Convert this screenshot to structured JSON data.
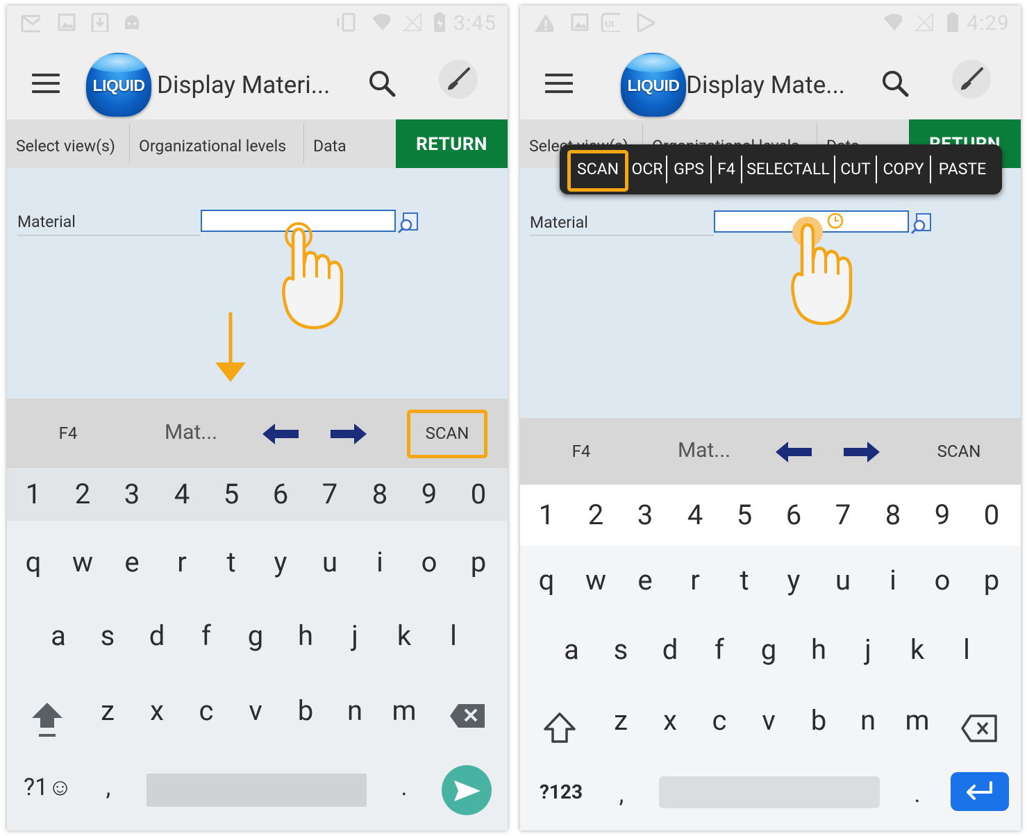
{
  "left": {
    "status": {
      "icons": [
        "gmail-icon",
        "image-icon",
        "download-icon",
        "android-icon",
        "vibrate-icon",
        "wifi-icon",
        "no-signal-icon",
        "battery-charging-icon"
      ],
      "time": "3:45"
    },
    "app_bar": {
      "logo_text": "LIQUID",
      "title": "Display Materi..."
    },
    "tabs": [
      "Select view(s)",
      "Organizational levels",
      "Data"
    ],
    "return_label": "RETURN",
    "form": {
      "material_label": "Material",
      "material_value": ""
    },
    "toolbar": {
      "f4": "F4",
      "field": "Mat...",
      "scan": "SCAN"
    },
    "keyboard": {
      "numbers": [
        "1",
        "2",
        "3",
        "4",
        "5",
        "6",
        "7",
        "8",
        "9",
        "0"
      ],
      "row1": [
        "q",
        "w",
        "e",
        "r",
        "t",
        "y",
        "u",
        "i",
        "o",
        "p"
      ],
      "row2": [
        "a",
        "s",
        "d",
        "f",
        "g",
        "h",
        "j",
        "k",
        "l"
      ],
      "row3": [
        "z",
        "x",
        "c",
        "v",
        "b",
        "n",
        "m"
      ],
      "symbols": "?1☺",
      "comma": ",",
      "period": "."
    }
  },
  "right": {
    "status": {
      "icons": [
        "warning-icon",
        "image-icon",
        "liquid-ui-icon",
        "play-store-icon",
        "wifi-icon",
        "no-signal-icon",
        "battery-icon"
      ],
      "time": "4:29"
    },
    "app_bar": {
      "logo_text": "LIQUID",
      "title": "Display Mate..."
    },
    "tabs": [
      "Select view(s)",
      "Organizational levels",
      "Data"
    ],
    "return_label": "RETURN",
    "context_menu": [
      "SCAN",
      "OCR",
      "GPS",
      "F4",
      "SELECTALL",
      "CUT",
      "COPY",
      "PASTE"
    ],
    "form": {
      "material_label": "Material",
      "material_value": ""
    },
    "toolbar": {
      "f4": "F4",
      "field": "Mat...",
      "scan": "SCAN"
    },
    "keyboard": {
      "numbers": [
        "1",
        "2",
        "3",
        "4",
        "5",
        "6",
        "7",
        "8",
        "9",
        "0"
      ],
      "row1": [
        "q",
        "w",
        "e",
        "r",
        "t",
        "y",
        "u",
        "i",
        "o",
        "p"
      ],
      "row2": [
        "a",
        "s",
        "d",
        "f",
        "g",
        "h",
        "j",
        "k",
        "l"
      ],
      "row3": [
        "z",
        "x",
        "c",
        "v",
        "b",
        "n",
        "m"
      ],
      "symbols": "?123",
      "comma": ",",
      "period": "."
    }
  },
  "colors": {
    "accent_highlight": "#f5a615",
    "return_green": "#0b7d3a",
    "input_border": "#2f6fc3",
    "send_teal": "#48b3a3",
    "enter_blue": "#1a73e8",
    "nav_arrow": "#1b2d7a"
  }
}
